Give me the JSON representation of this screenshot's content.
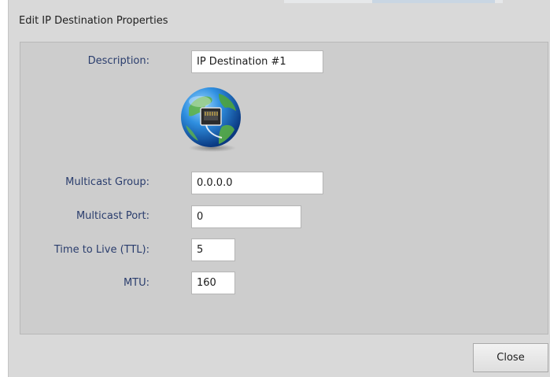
{
  "dialog": {
    "title": "Edit IP Destination Properties"
  },
  "form": {
    "description": {
      "label": "Description:",
      "value": "IP Destination #1"
    },
    "icon": "network-globe-icon",
    "multicast_group": {
      "label": "Multicast Group:",
      "value": "0.0.0.0"
    },
    "multicast_port": {
      "label": "Multicast Port:",
      "value": "0"
    },
    "ttl": {
      "label": "Time to Live (TTL):",
      "value": "5"
    },
    "mtu": {
      "label": "MTU:",
      "value": "160"
    }
  },
  "footer": {
    "close_label": "Close"
  },
  "colors": {
    "label_text": "#2a3d6d",
    "dialog_bg": "#d9d9d9",
    "panel_bg": "#cdcdcd"
  }
}
